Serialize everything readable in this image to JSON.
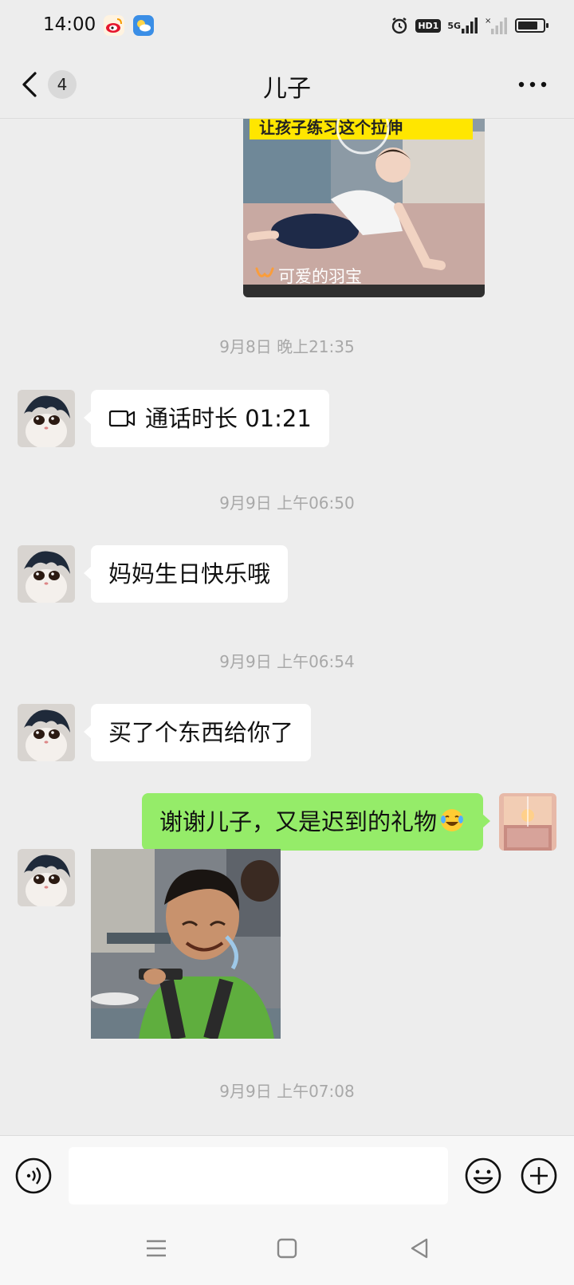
{
  "status_bar": {
    "time": "14:00",
    "hd_badge": "HD1",
    "signal_label": "5G",
    "left_icons": [
      "weibo-icon",
      "weather-icon"
    ],
    "right_icons": [
      "alarm-icon",
      "hd-icon",
      "signal-5g-icon",
      "signal-icon",
      "battery-icon"
    ],
    "battery_level": 0.8
  },
  "nav": {
    "title": "儿子",
    "unread_count": "4",
    "back_icon": "chevron-left-icon",
    "more_icon": "more-horizontal-icon"
  },
  "messages": {
    "video_card": {
      "caption": "可爱的羽宝",
      "banner_text": "让孩子练习这个拉伸"
    },
    "ts1": "9月8日 晚上21:35",
    "call": {
      "label": "通话时长 01:21",
      "icon": "video-call-icon"
    },
    "ts2": "9月9日 上午06:50",
    "msg1": "妈妈生日快乐哦",
    "ts3": "9月9日 上午06:54",
    "msg2": "买了个东西给你了",
    "msg3": "谢谢儿子，又是迟到的礼物",
    "msg3_emoji": "laughing-tears-emoji",
    "ts4": "9月9日 上午07:08"
  },
  "input_bar": {
    "value": "",
    "icons": [
      "voice-icon",
      "emoji-icon",
      "plus-icon"
    ]
  },
  "colors": {
    "background": "#ededed",
    "sent_bubble": "#95ec69",
    "received_bubble": "#ffffff",
    "timestamp": "#a8a8a8"
  }
}
